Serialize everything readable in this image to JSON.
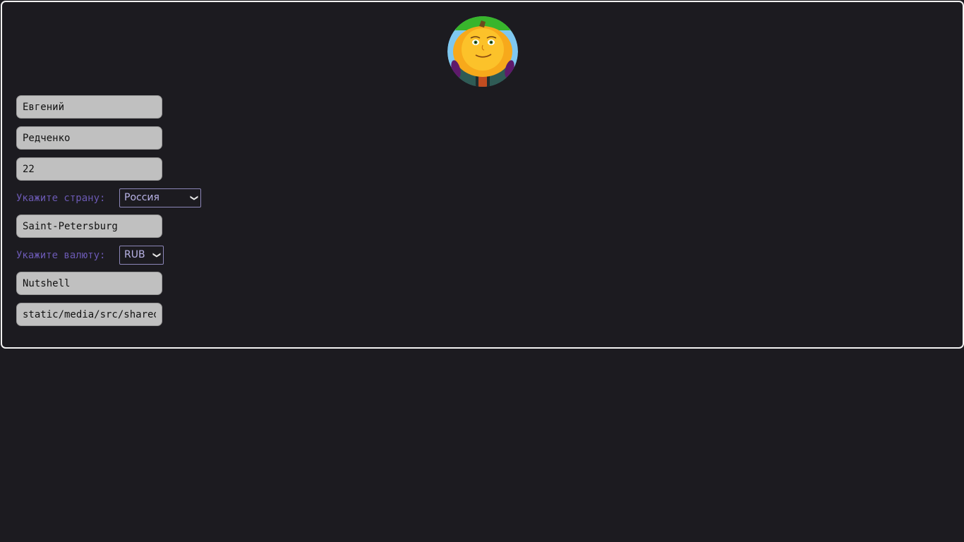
{
  "profile": {
    "avatar_alt": "pumpkin-character-avatar"
  },
  "form": {
    "first_name": "Евгений",
    "last_name": "Редченко",
    "age": "22",
    "country_label": "Укажите страну:",
    "country_selected": "Россия",
    "city": "Saint-Petersburg",
    "currency_label": "Укажите валюту:",
    "currency_selected": "RUB",
    "nickname": "Nutshell",
    "avatar_path": "static/media/src/shared/"
  },
  "icons": {
    "select_chevron": "chevron-down-icon"
  },
  "colors": {
    "background": "#1c1b20",
    "panel_border": "#f2f2f2",
    "field_bg": "#c0c0c0",
    "label_text": "#6b59b3",
    "select_text": "#b9b3e6"
  }
}
